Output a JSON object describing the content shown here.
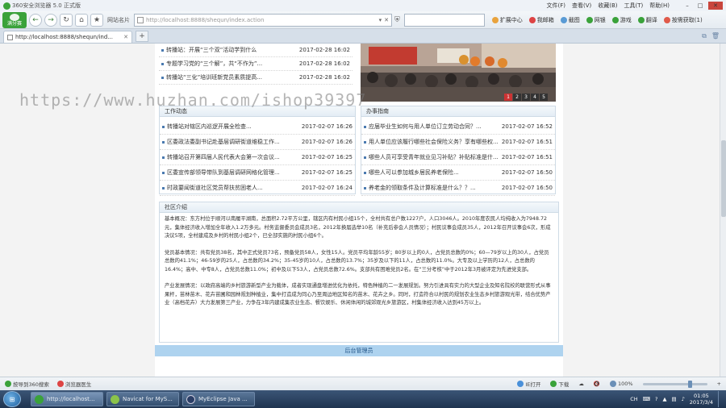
{
  "window": {
    "title": "360安全浏览器 5.0 正式版",
    "menus": [
      "文件(F)",
      "查看(V)",
      "收藏(B)",
      "工具(T)",
      "帮助(H)"
    ]
  },
  "toolbar": {
    "logo_label": "满分赛",
    "address_label": "网站名片",
    "url": "http://localhost:8888/shequn/index.action",
    "items": [
      "扩展中心",
      "我邮箱",
      "截图",
      "网银",
      "游戏",
      "翻译",
      "按需获取(1)"
    ]
  },
  "tab": {
    "label": "http://localhost:8888/shequn/ind..."
  },
  "watermark": "https://www.huzhan.com/ishop39397",
  "top_news": [
    {
      "title": "转播站：开展“三个双”活动学到什么",
      "date": "2017-02-28 16:02"
    },
    {
      "title": "专题学习党的“三个解”，共“不作为”...",
      "date": "2017-02-28 16:02"
    },
    {
      "title": "转播站“三化”培训班新党员素质提高...",
      "date": "2017-02-28 16:02"
    }
  ],
  "carousel": {
    "pages": [
      "1",
      "2",
      "3",
      "4",
      "5"
    ],
    "active": 0
  },
  "work_news": {
    "title": "工作动态",
    "items": [
      {
        "title": "转播站对辖区内巡逻开展全检查...",
        "date": "2017-02-07 16:26"
      },
      {
        "title": "区委政法委副书记赴基层调研街道维稳工作...",
        "date": "2017-02-07 16:26"
      },
      {
        "title": "转播站召开第四届人民代表大会第一次会议...",
        "date": "2017-02-07 16:25"
      },
      {
        "title": "区委宣传部领导带队到基层调研网格化管理...",
        "date": "2017-02-07 16:25"
      },
      {
        "title": "时政要闻街道社区党员帮扶贫困老人...",
        "date": "2017-02-07 16:24"
      }
    ]
  },
  "guide": {
    "title": "办事指南",
    "items": [
      {
        "title": "应届毕业生如何与用人单位订立劳动合同？...",
        "date": "2017-02-07 16:52"
      },
      {
        "title": "用人单位应该履行哪些社会保险义务？享有哪些权...",
        "date": "2017-02-07 16:51"
      },
      {
        "title": "哪些人员可享受青年就业见习补贴？补贴标准是什...",
        "date": "2017-02-07 16:51"
      },
      {
        "title": "哪些人可以参加城乡居民养老保险...",
        "date": "2017-02-07 16:50"
      },
      {
        "title": "养老金的领取条件及计算标准是什么？？...",
        "date": "2017-02-07 16:50"
      }
    ]
  },
  "intro": {
    "title": "社区介绍",
    "paragraphs": [
      "基本概况：东方村位于顺河以南履平湖南，总面积2.72平方公里，辖区内有村民小组15个，全村共有总户数1227户，人口3046人。2010年度农民人均纯收入为7948.72元，集体经济收入增加全年收入1.2万多元。村务监督委员会成员3名，2012年换届选举10名（补充后参会人员情况）；村民议事会成员35人，2012年召开议事会6次，形成决议5项，全村建成及乡村的村民小组2个，已全部实施的村民小组6个。",
      "党员基本情况：共有党员38名，其中正式党员73名，预备党员58人，女性15人。党员平均年龄55岁；80岁以上的0人，占党员总数的0%；60—79岁以上的30人，占党员总数的41.1%；46-59岁的25人，占总数的34.2%；35-45岁的10人，占总数的13.7%；35岁及以下的11人，占总数的11.0%。大专及以上学历的12人，占总数的16.4%；高中、中专8人，占党员总数11.0%；初中及以下53人，占党员总数72.6%。支部共有困难党员2名。在“三分考核”中于2012年3月被评定为先进党支部。",
      "产业发展情况：以政府高端的乡村旅游新型产业为载体，成者实现通盘增进优化为依托，特色种植的二一发展规划。努力引进具有实力的大型企业及知名院校的联营形式从事果杆，苗林苗木、花卉苗圃和园林规划种植业，集中打造成为同心乃至周边地区知名的苗木、花卉之乡。同时，打造符合以村民的规划农业生态乡村旅游观光带，结合优势产业（高档花卉）大力发展第三产业，力争在3年内建成集农业生态、餐饮娱乐、休闲体闲的城郊观光乡旅游区，村集体经济收入达到45万以上。"
    ]
  },
  "admin_link": "后台管理员",
  "statusbar": {
    "left": [
      "按导到360搜索",
      "浏览器医生"
    ],
    "right": [
      "IE打开",
      "下载",
      "100%"
    ]
  },
  "taskbar": {
    "tasks": [
      {
        "label": "http://localhost..."
      },
      {
        "label": "Navicat for MyS..."
      },
      {
        "label": "MyEclipse Java ..."
      }
    ],
    "tray_lang": "CH",
    "time": "01:05",
    "date": "2017/3/4"
  },
  "colors": {
    "accent": "#3aa23a",
    "link_bar": "#aed3ef",
    "taskbar": "#2a4262"
  }
}
